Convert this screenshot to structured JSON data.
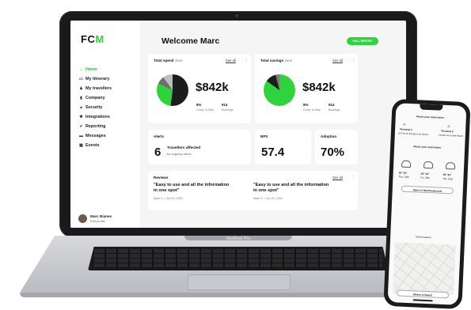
{
  "laptop": {
    "brand_label": "MacBook Pro",
    "app": {
      "logo": {
        "main": "FC",
        "accent": "M"
      },
      "nav": [
        {
          "label": "Home",
          "icon": "home-icon",
          "glyph": "⌂",
          "active": true
        },
        {
          "label": "My itinerary",
          "icon": "itinerary-icon",
          "glyph": "▭"
        },
        {
          "label": "My travellers",
          "icon": "travellers-icon",
          "glyph": "♟"
        },
        {
          "label": "Company",
          "icon": "company-icon",
          "glyph": "▮"
        },
        {
          "label": "Security",
          "icon": "security-icon",
          "glyph": "▲"
        },
        {
          "label": "Integrations",
          "icon": "integrations-icon",
          "glyph": "✱"
        },
        {
          "label": "Reporting",
          "icon": "reporting-icon",
          "glyph": "✔"
        },
        {
          "label": "Messages",
          "icon": "messages-icon",
          "glyph": "▬"
        },
        {
          "label": "Events",
          "icon": "events-icon",
          "glyph": "▦"
        }
      ],
      "profile": {
        "name": "Marc Bianes",
        "edit": "Edit profile"
      },
      "welcome": "Welcome Marc",
      "report_button": "FULL REPORT",
      "spend": {
        "title": "Total spend",
        "period": "June",
        "see_all": "See all",
        "amount": "$842k",
        "stat1_value": "8%",
        "stat1_label": "Comp. to May",
        "stat2_value": "914",
        "stat2_label": "Bookings"
      },
      "savings": {
        "title": "Total savings",
        "period": "June",
        "see_all": "See all",
        "amount": "$842k",
        "stat1_value": "8%",
        "stat1_label": "Comp. to May",
        "stat2_value": "914",
        "stat2_label": "Bookings"
      },
      "alerts": {
        "title": "Alerts",
        "count": "6",
        "label": "Travellers affected",
        "sub": "by ongoing alerts"
      },
      "nps": {
        "title": "NPS",
        "value": "57.4"
      },
      "adoption": {
        "title": "Adoption",
        "value": "70%"
      },
      "reviews": {
        "title": "Reviews",
        "see_all": "See all",
        "items": [
          {
            "quote": "\"Easy to use and all the information in one spot\"",
            "meta": "Mark H. • Jun 20, 2020"
          },
          {
            "quote": "\"Easy to use and all the information in one spot\"",
            "meta": "Mark H. • Jun 20, 2020"
          }
        ]
      }
    }
  },
  "phone": {
    "header": "About your reservation",
    "terminal1": "Terminal 1",
    "terminal1_sub": "En Paz de Zaragoza en Airport",
    "terminal2": "Terminal 2",
    "terminal2_sub": "Charles de Gaulle Airport",
    "section2": "About your reservation",
    "weather": [
      {
        "temp": "35° 32°",
        "day": "Thu, 19th"
      },
      {
        "temp": "35° 32°",
        "day": "Fri, 20th"
      },
      {
        "temp": "35° 32°",
        "day": "Sat, 21st"
      }
    ],
    "open_btn": "Open in Weatherground",
    "map_label": "Hotel location",
    "map_btn": "Where to Beach"
  },
  "colors": {
    "accent": "#2fd43c",
    "dark": "#1c1c1c",
    "card": "#ffffff",
    "screen_bg": "#f4f5f4"
  }
}
